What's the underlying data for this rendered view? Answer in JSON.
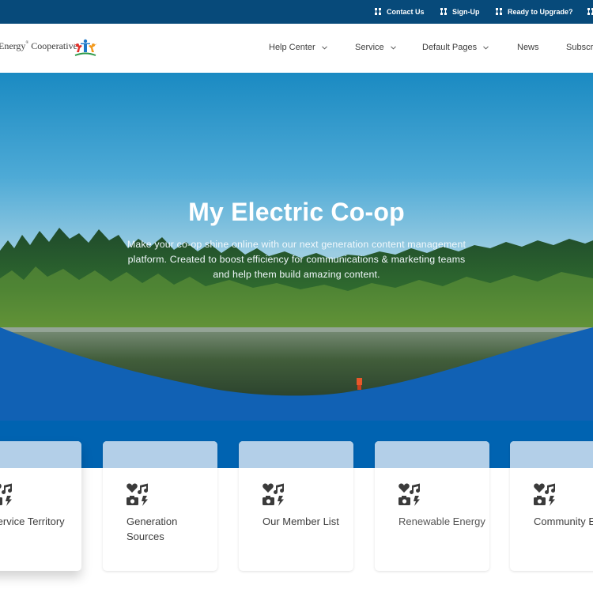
{
  "utility_bar": {
    "items": [
      {
        "label": "Contact Us",
        "icon": "sitemap-icon"
      },
      {
        "label": "Sign-Up",
        "icon": "sitemap-icon"
      },
      {
        "label": "Ready to Upgrade?",
        "icon": "sitemap-icon"
      },
      {
        "label": "",
        "icon": "sitemap-icon"
      }
    ],
    "colors": {
      "background": "#074a7a",
      "text": "#ffffff"
    }
  },
  "header": {
    "brand_name": "Energy",
    "brand_sup": "®",
    "brand_suffix": " Cooperative",
    "logo_icon": "people-arms-raised-logo",
    "nav": [
      {
        "label": "Help Center",
        "has_dropdown": true
      },
      {
        "label": "Service",
        "has_dropdown": true
      },
      {
        "label": "Default Pages",
        "has_dropdown": true
      },
      {
        "label": "News",
        "has_dropdown": false
      },
      {
        "label": "Subscribe",
        "has_dropdown": false
      }
    ]
  },
  "hero": {
    "title": "My Electric Co-op",
    "subtitle": "Make your co-op shine online with our next generation content management platform. Created to boost efficiency for communications & marketing teams and help them build amazing content."
  },
  "tiles": {
    "band_color": "#0063b1",
    "card_accent": "#b3cfe8",
    "icon": "heart-music-camera-bolt-icon",
    "items": [
      {
        "label": "Service Territory"
      },
      {
        "label": "Generation Sources"
      },
      {
        "label": "Our Member List"
      },
      {
        "label": "Renewable Energy"
      },
      {
        "label": "Community Events"
      }
    ]
  }
}
